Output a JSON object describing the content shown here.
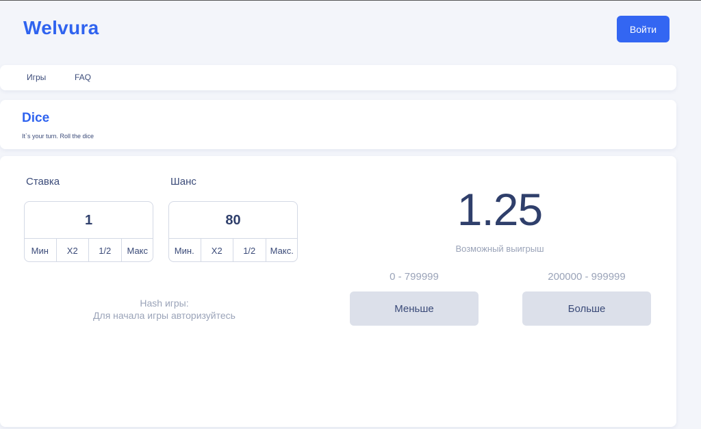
{
  "header": {
    "logo": "Welvura",
    "login_label": "Войти"
  },
  "nav": {
    "items": [
      "Игры",
      "FAQ"
    ]
  },
  "game": {
    "title": "Dice",
    "subtitle": "It`s your turn. Roll the dice"
  },
  "bet": {
    "label": "Ставка",
    "value": "1",
    "buttons": [
      "Мин",
      "X2",
      "1/2",
      "Макс"
    ]
  },
  "chance": {
    "label": "Шанс",
    "value": "80",
    "buttons": [
      "Мин.",
      "X2",
      "1/2",
      "Макс."
    ]
  },
  "hash": {
    "label": "Hash игры:",
    "message": "Для начала игры авторизуйтесь"
  },
  "payout": {
    "value": "1.25",
    "label": "Возможный выигрыш"
  },
  "under": {
    "range": "0 - 799999",
    "label": "Меньше"
  },
  "over": {
    "range": "200000 - 999999",
    "label": "Больше"
  }
}
